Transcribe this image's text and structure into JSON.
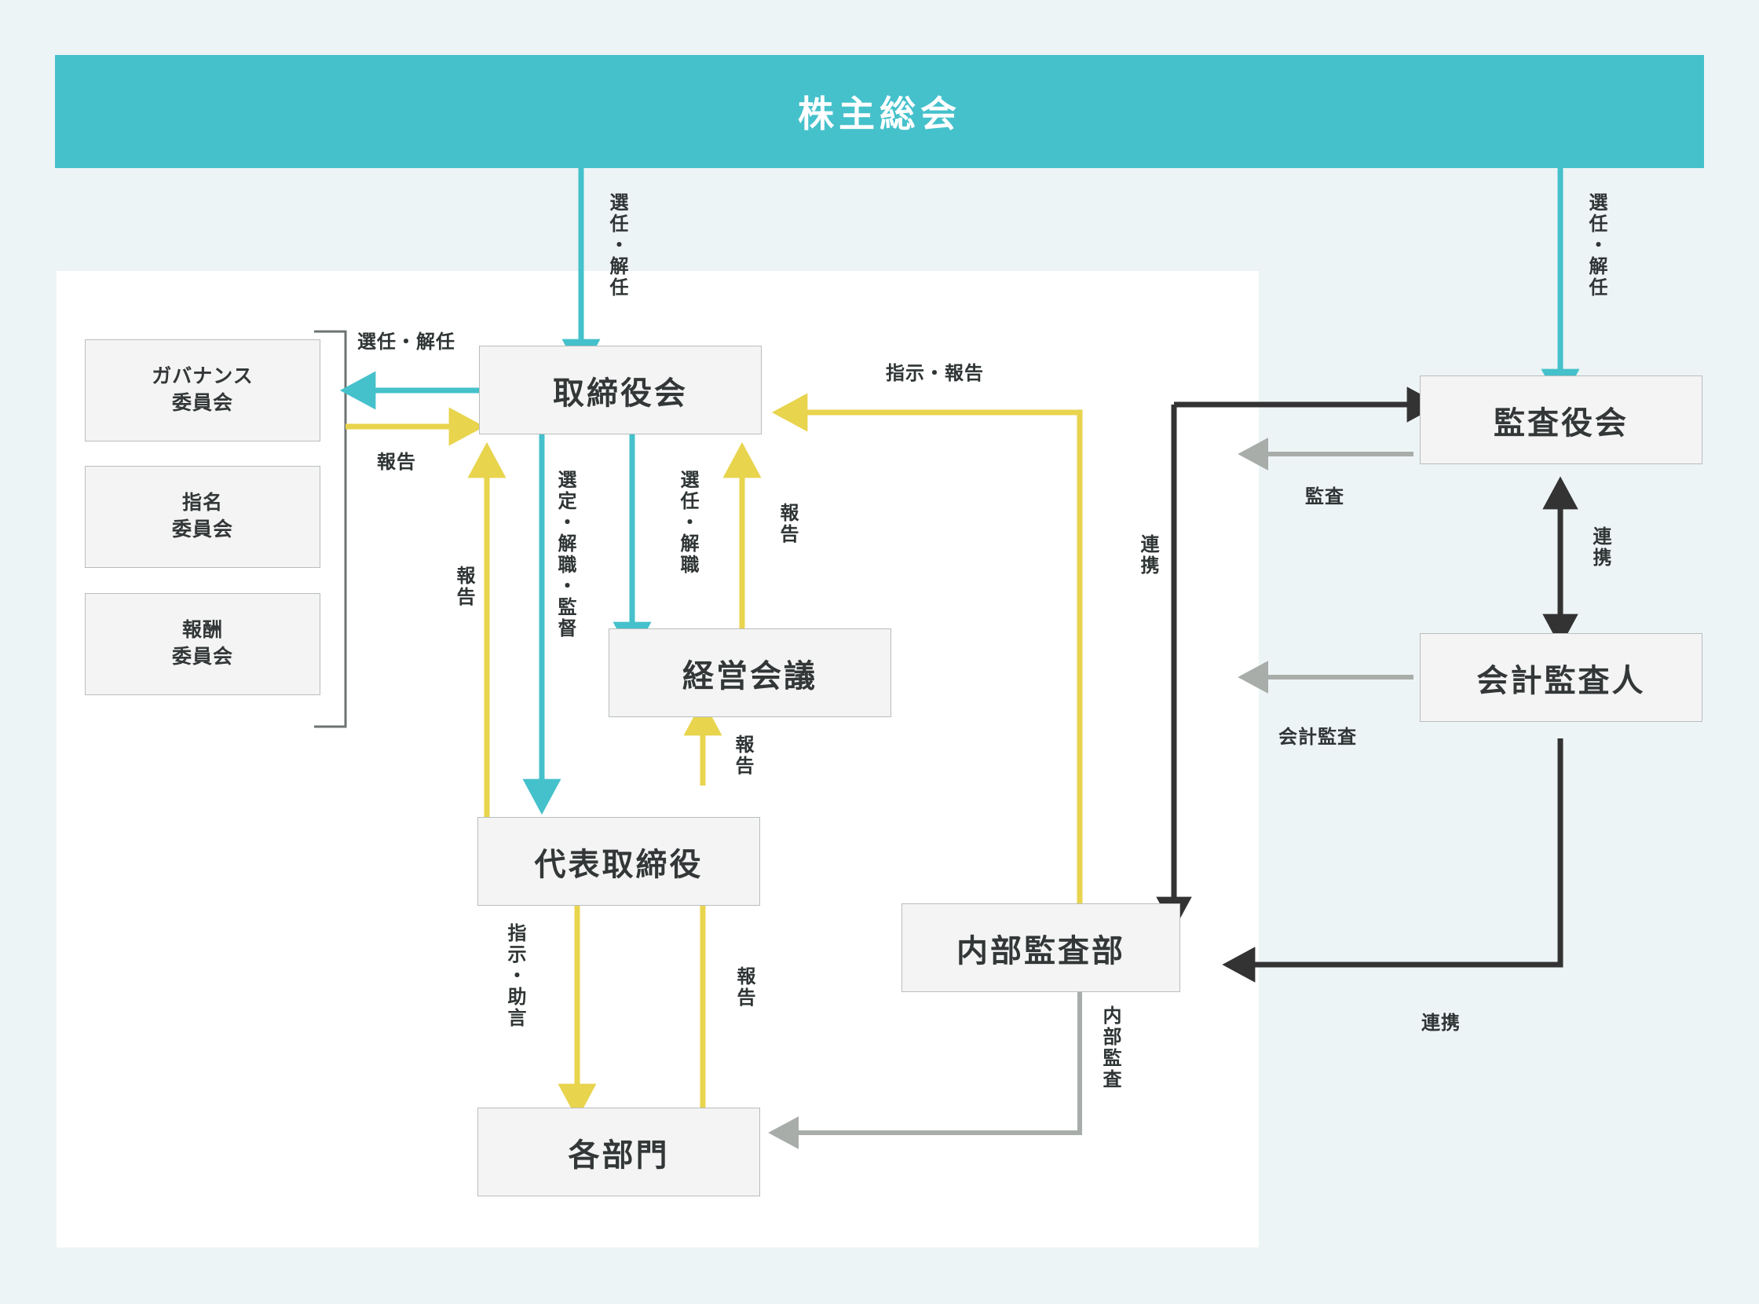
{
  "header": {
    "title": "株主総会"
  },
  "colors": {
    "background": "#edf4f6",
    "panel": "#ffffff",
    "header": "#45c1cb",
    "teal": "#45c1cb",
    "yellow": "#e8d44d",
    "gray": "#a8adaa",
    "black": "#333333",
    "node_fill": "#f4f4f4",
    "node_border": "#b9bdbd",
    "text": "#333737"
  },
  "nodes": {
    "governance_committee": {
      "line1": "ガバナンス",
      "line2": "委員会"
    },
    "nomination_committee": {
      "line1": "指名",
      "line2": "委員会"
    },
    "compensation_committee": {
      "line1": "報酬",
      "line2": "委員会"
    },
    "board_of_directors": {
      "label": "取締役会"
    },
    "management_meeting": {
      "label": "経営会議"
    },
    "representative_director": {
      "label": "代表取締役"
    },
    "departments": {
      "label": "各部門"
    },
    "internal_audit": {
      "label": "内部監査部"
    },
    "audit_board": {
      "label": "監査役会"
    },
    "accounting_auditor": {
      "label": "会計監査人"
    }
  },
  "edge_labels": {
    "shareholders_to_board": "選任・解任",
    "shareholders_to_audit_board": "選任・解任",
    "board_to_committees": "選任・解任",
    "committees_to_board": "報告",
    "board_to_repdir_select": "選定・解職・監督",
    "repdir_to_board_report": "報告",
    "board_to_mgmt_select": "選任・解職",
    "mgmt_to_board_report": "報告",
    "mgmt_report_from_repdir": "報告",
    "repdir_to_depts": "指示・助言",
    "depts_to_repdir_report": "報告",
    "internal_audit_to_board": "指示・報告",
    "internal_audit_cooperation": "連携",
    "audit_board_audit": "監査",
    "audit_board_accounting_cooperation": "連携",
    "accounting_audit": "会計監査",
    "internal_audit_to_depts": "内部監査",
    "accounting_internal_cooperation": "連携"
  },
  "chart_data": {
    "type": "diagram",
    "title": "株主総会 コーポレートガバナンス体制図",
    "edges": [
      {
        "from": "株主総会",
        "to": "取締役会",
        "label": "選任・解任",
        "color": "teal"
      },
      {
        "from": "株主総会",
        "to": "監査役会",
        "label": "選任・解任",
        "color": "teal"
      },
      {
        "from": "取締役会",
        "to": "各委員会",
        "label": "選任・解任",
        "color": "teal"
      },
      {
        "from": "各委員会",
        "to": "取締役会",
        "label": "報告",
        "color": "yellow"
      },
      {
        "from": "取締役会",
        "to": "代表取締役",
        "label": "選定・解職・監督",
        "color": "teal"
      },
      {
        "from": "代表取締役",
        "to": "取締役会",
        "label": "報告",
        "color": "yellow"
      },
      {
        "from": "取締役会",
        "to": "経営会議",
        "label": "選任・解職",
        "color": "teal"
      },
      {
        "from": "経営会議",
        "to": "取締役会",
        "label": "報告",
        "color": "yellow"
      },
      {
        "from": "代表取締役",
        "to": "経営会議",
        "label": "報告",
        "color": "yellow"
      },
      {
        "from": "代表取締役",
        "to": "各部門",
        "label": "指示・助言",
        "color": "yellow"
      },
      {
        "from": "各部門",
        "to": "代表取締役",
        "label": "報告",
        "color": "yellow"
      },
      {
        "from": "内部監査部",
        "to": "取締役会",
        "label": "指示・報告",
        "color": "yellow"
      },
      {
        "from": "監査役会",
        "to": "内部監査部",
        "label": "連携",
        "color": "black"
      },
      {
        "from": "監査役会",
        "to": "取締役会",
        "label": "監査",
        "color": "gray"
      },
      {
        "from": "監査役会",
        "to": "会計監査人",
        "label": "連携",
        "color": "black"
      },
      {
        "from": "会計監査人",
        "to": "取締役会",
        "label": "会計監査",
        "color": "gray"
      },
      {
        "from": "内部監査部",
        "to": "各部門",
        "label": "内部監査",
        "color": "gray"
      },
      {
        "from": "会計監査人",
        "to": "内部監査部",
        "label": "連携",
        "color": "black"
      }
    ]
  }
}
